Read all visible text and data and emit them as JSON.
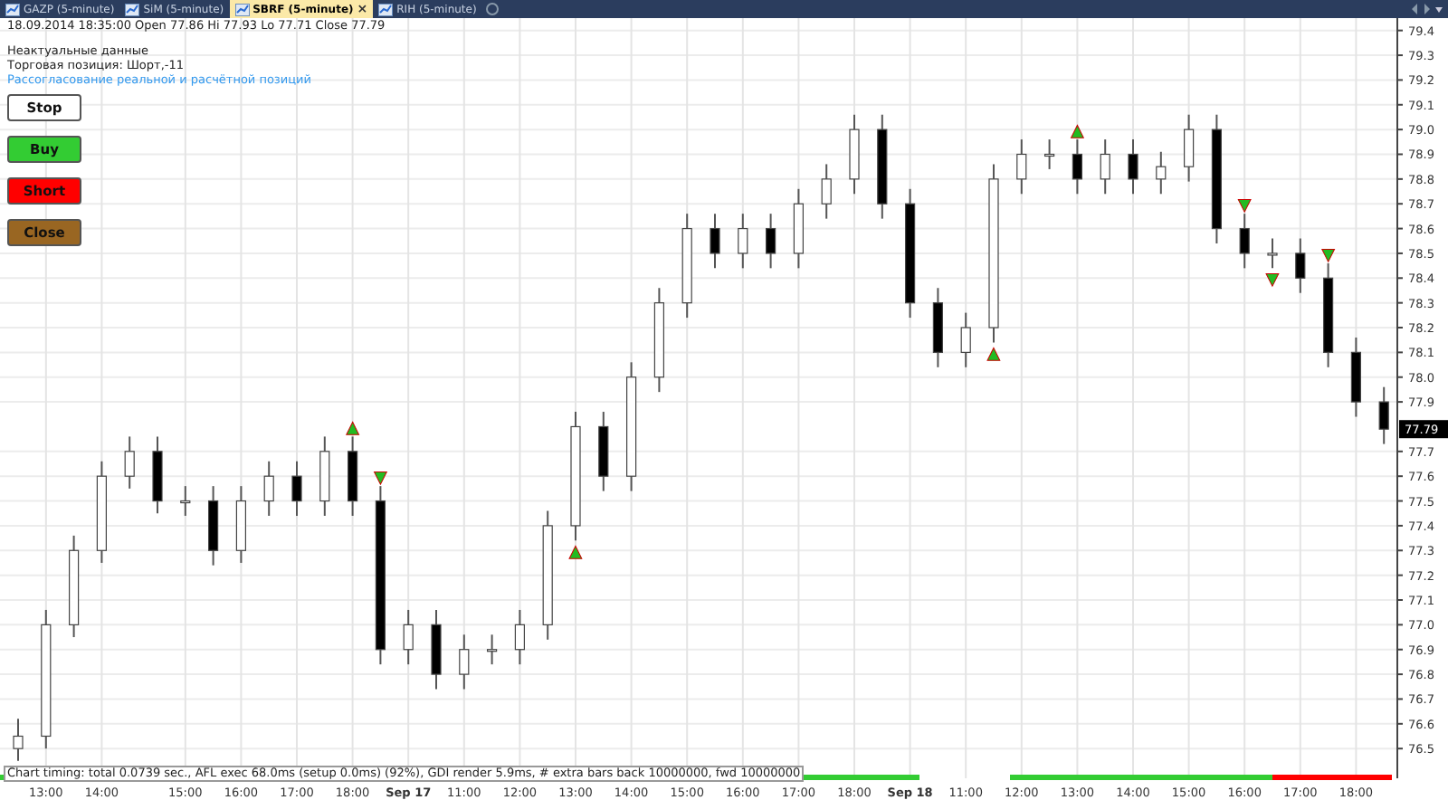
{
  "tabs": [
    {
      "label": "GAZP (5-minute)",
      "selected": false
    },
    {
      "label": "SiM (5-minute)",
      "selected": false
    },
    {
      "label": "SBRF (5-minute)",
      "selected": true,
      "close": "×"
    },
    {
      "label": "RIH (5-minute)",
      "selected": false
    }
  ],
  "header": {
    "quote": "18.09.2014 18:35:00 Open 77.86 Hi 77.93 Lo 77.71 Close 77.79",
    "status_lines": [
      {
        "text": "Неактуальные данные",
        "kind": "plain"
      },
      {
        "text": "Торговая позиция: Шорт,-11",
        "kind": "plain"
      },
      {
        "text": "Рассогласование реальной и расчётной позиций",
        "kind": "warning"
      }
    ]
  },
  "buttons": [
    {
      "label": "Stop",
      "color": "#ffffff"
    },
    {
      "label": "Buy",
      "color": "#33cc33"
    },
    {
      "label": "Short",
      "color": "#ff0000"
    },
    {
      "label": "Close",
      "color": "#996622"
    }
  ],
  "chart": {
    "last_price": "77.79",
    "footer": "Chart timing: total 0.0739 sec., AFL exec 68.0ms (setup 0.0ms) (92%), GDI render 5.9ms, # extra bars back 10000000, fwd 10000000",
    "chart_data": {
      "type": "candlestick",
      "grid": true,
      "ylim": [
        76.38,
        79.45
      ],
      "yticks": [
        76.5,
        76.6,
        76.7,
        76.8,
        76.9,
        {
          "value": 77,
          "label": "77.0"
        },
        77.1,
        77.2,
        77.3,
        77.4,
        77.5,
        77.6,
        77.7,
        77.9,
        {
          "value": 78,
          "label": "78.0"
        },
        78.1,
        78.2,
        78.3,
        78.4,
        78.5,
        78.6,
        78.7,
        78.8,
        78.9,
        {
          "value": 79,
          "label": "79.0"
        },
        79.1,
        79.2,
        79.3,
        79.4
      ],
      "categories": [
        null,
        "13:00",
        null,
        "14:00",
        null,
        null,
        "15:00",
        null,
        "16:00",
        null,
        "17:00",
        null,
        "18:00",
        null,
        "Sep 17",
        null,
        "11:00",
        null,
        "12:00",
        null,
        "13:00",
        null,
        "14:00",
        null,
        "15:00",
        null,
        "16:00",
        null,
        "17:00",
        null,
        "18:00",
        null,
        "Sep 18",
        null,
        "11:00",
        null,
        "12:00",
        null,
        "13:00",
        null,
        "14:00",
        null,
        "15:00",
        null,
        "16:00",
        null,
        "17:00",
        null,
        "18:00",
        null
      ],
      "ohlc": [
        [
          76.5,
          76.62,
          76.45,
          76.55
        ],
        [
          76.55,
          77.06,
          76.5,
          77.0
        ],
        [
          77.0,
          77.36,
          76.95,
          77.3
        ],
        [
          77.3,
          77.66,
          77.25,
          77.6
        ],
        [
          77.6,
          77.76,
          77.55,
          77.7
        ],
        [
          77.7,
          77.76,
          77.45,
          77.5
        ],
        [
          77.5,
          77.56,
          77.44,
          77.5
        ],
        [
          77.5,
          77.56,
          77.24,
          77.3
        ],
        [
          77.3,
          77.56,
          77.25,
          77.5
        ],
        [
          77.5,
          77.66,
          77.44,
          77.6
        ],
        [
          77.6,
          77.66,
          77.44,
          77.5
        ],
        [
          77.5,
          77.76,
          77.44,
          77.7
        ],
        [
          77.7,
          77.76,
          77.44,
          77.5
        ],
        [
          77.5,
          77.56,
          76.84,
          76.9
        ],
        [
          76.9,
          77.06,
          76.84,
          77.0
        ],
        [
          77.0,
          77.06,
          76.74,
          76.8
        ],
        [
          76.8,
          76.96,
          76.74,
          76.9
        ],
        [
          76.9,
          76.96,
          76.84,
          76.9
        ],
        [
          76.9,
          77.06,
          76.84,
          77.0
        ],
        [
          77.0,
          77.46,
          76.94,
          77.4
        ],
        [
          77.4,
          77.86,
          77.34,
          77.8
        ],
        [
          77.8,
          77.86,
          77.54,
          77.6
        ],
        [
          77.6,
          78.06,
          77.54,
          78.0
        ],
        [
          78.0,
          78.36,
          77.94,
          78.3
        ],
        [
          78.3,
          78.66,
          78.24,
          78.6
        ],
        [
          78.6,
          78.66,
          78.44,
          78.5
        ],
        [
          78.5,
          78.66,
          78.44,
          78.6
        ],
        [
          78.6,
          78.66,
          78.44,
          78.5
        ],
        [
          78.5,
          78.76,
          78.44,
          78.7
        ],
        [
          78.7,
          78.86,
          78.64,
          78.8
        ],
        [
          78.8,
          79.06,
          78.74,
          79.0
        ],
        [
          79.0,
          79.06,
          78.64,
          78.7
        ],
        [
          78.7,
          78.76,
          78.24,
          78.3
        ],
        [
          78.3,
          78.36,
          78.04,
          78.1
        ],
        [
          78.1,
          78.26,
          78.04,
          78.2
        ],
        [
          78.2,
          78.86,
          78.14,
          78.8
        ],
        [
          78.8,
          78.96,
          78.74,
          78.9
        ],
        [
          78.9,
          78.96,
          78.84,
          78.9
        ],
        [
          78.9,
          78.96,
          78.74,
          78.8
        ],
        [
          78.8,
          78.96,
          78.74,
          78.9
        ],
        [
          78.9,
          78.96,
          78.74,
          78.8
        ],
        [
          78.8,
          78.91,
          78.74,
          78.85
        ],
        [
          78.85,
          79.06,
          78.79,
          79.0
        ],
        [
          79.0,
          79.06,
          78.54,
          78.6
        ],
        [
          78.6,
          78.66,
          78.44,
          78.5
        ],
        [
          78.5,
          78.56,
          78.44,
          78.5
        ],
        [
          78.5,
          78.56,
          78.34,
          78.4
        ],
        [
          78.4,
          78.46,
          78.04,
          78.1
        ],
        [
          78.1,
          78.16,
          77.84,
          77.9
        ],
        [
          77.9,
          77.96,
          77.73,
          77.79
        ]
      ],
      "annotations": [
        "▲",
        "▼",
        "▲",
        "▲",
        "▲",
        "▼",
        "▼",
        "▼"
      ]
    }
  }
}
